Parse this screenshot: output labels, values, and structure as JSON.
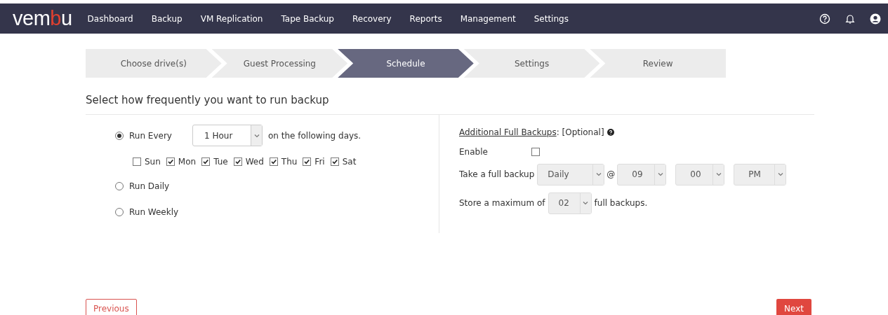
{
  "logo": [
    {
      "text": "vem",
      "color": "#ffffff"
    },
    {
      "text": "b",
      "color": "#e0402f"
    },
    {
      "text": "u",
      "color": "#ffffff"
    }
  ],
  "nav": [
    "Dashboard",
    "Backup",
    "VM Replication",
    "Tape Backup",
    "Recovery",
    "Reports",
    "Management",
    "Settings"
  ],
  "steps": [
    {
      "label": "Choose drive(s)",
      "selected": false
    },
    {
      "label": "Guest Processing",
      "selected": false
    },
    {
      "label": "Schedule",
      "selected": true
    },
    {
      "label": "Settings",
      "selected": false
    },
    {
      "label": "Review",
      "selected": false
    }
  ],
  "heading": "Select how frequently you want to run backup",
  "schedule": [
    {
      "label": "Run Every",
      "selected": true,
      "select": "1 Hour",
      "suffix": "on the following days."
    },
    {
      "label": "Run Daily",
      "selected": false
    },
    {
      "label": "Run Weekly",
      "selected": false
    }
  ],
  "days": [
    {
      "label": "Sun",
      "checked": false
    },
    {
      "label": "Mon",
      "checked": true
    },
    {
      "label": "Tue",
      "checked": true
    },
    {
      "label": "Wed",
      "checked": true
    },
    {
      "label": "Thu",
      "checked": true
    },
    {
      "label": "Fri",
      "checked": true
    },
    {
      "label": "Sat",
      "checked": true
    }
  ],
  "full_backups": {
    "title": "Additional Full Backups",
    "title_suffix": ": [Optional]",
    "enable_label": "Enable",
    "enabled": false,
    "take_label": "Take a full backup",
    "frequency": {
      "value": "Daily",
      "disabled": true
    },
    "at": "@",
    "hour": {
      "value": "09",
      "disabled": true
    },
    "minute": {
      "value": "00",
      "disabled": true
    },
    "ampm": {
      "value": "PM",
      "disabled": true
    },
    "store_label": "Store a maximum of",
    "store": {
      "value": "02",
      "disabled": true
    },
    "store_suffix": "full backups."
  },
  "buttons": {
    "previous": "Previous",
    "next": "Next"
  }
}
